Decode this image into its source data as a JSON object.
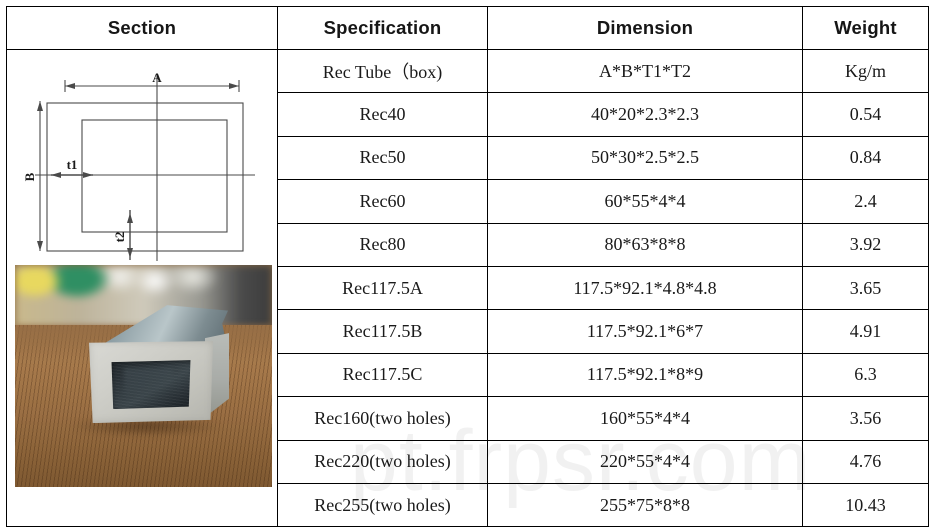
{
  "table": {
    "headers": [
      {
        "key": "section",
        "label": "Section"
      },
      {
        "key": "specification",
        "label": "Specification"
      },
      {
        "key": "dimension",
        "label": "Dimension"
      },
      {
        "key": "weight",
        "label": "Weight"
      }
    ],
    "rows": [
      {
        "specification": "Rec Tube（box)",
        "dimension": "A*B*T1*T2",
        "weight": "Kg/m"
      },
      {
        "specification": "Rec40",
        "dimension": "40*20*2.3*2.3",
        "weight": "0.54"
      },
      {
        "specification": "Rec50",
        "dimension": "50*30*2.5*2.5",
        "weight": "0.84"
      },
      {
        "specification": "Rec60",
        "dimension": "60*55*4*4",
        "weight": "2.4"
      },
      {
        "specification": "Rec80",
        "dimension": "80*63*8*8",
        "weight": "3.92"
      },
      {
        "specification": "Rec117.5A",
        "dimension": "117.5*92.1*4.8*4.8",
        "weight": "3.65"
      },
      {
        "specification": "Rec117.5B",
        "dimension": "117.5*92.1*6*7",
        "weight": "4.91"
      },
      {
        "specification": "Rec117.5C",
        "dimension": "117.5*92.1*8*9",
        "weight": "6.3"
      },
      {
        "specification": "Rec160(two holes)",
        "dimension": "160*55*4*4",
        "weight": "3.56"
      },
      {
        "specification": "Rec220(two holes)",
        "dimension": "220*55*4*4",
        "weight": "4.76"
      },
      {
        "specification": "Rec255(two holes)",
        "dimension": "255*75*8*8",
        "weight": "10.43"
      }
    ]
  },
  "section_cell": {
    "drawing": {
      "description": "rectangular tube cross-section engineering drawing",
      "labels": {
        "width": "A",
        "height": "B",
        "wall_side": "t1",
        "wall_bottom": "t2"
      },
      "line_color": "#4a4a4a"
    },
    "photo": {
      "description": "photograph of grey FRP rectangular tube on wooden table"
    }
  },
  "watermark": {
    "text": "pt.frpsr.com",
    "color": "#000000"
  }
}
